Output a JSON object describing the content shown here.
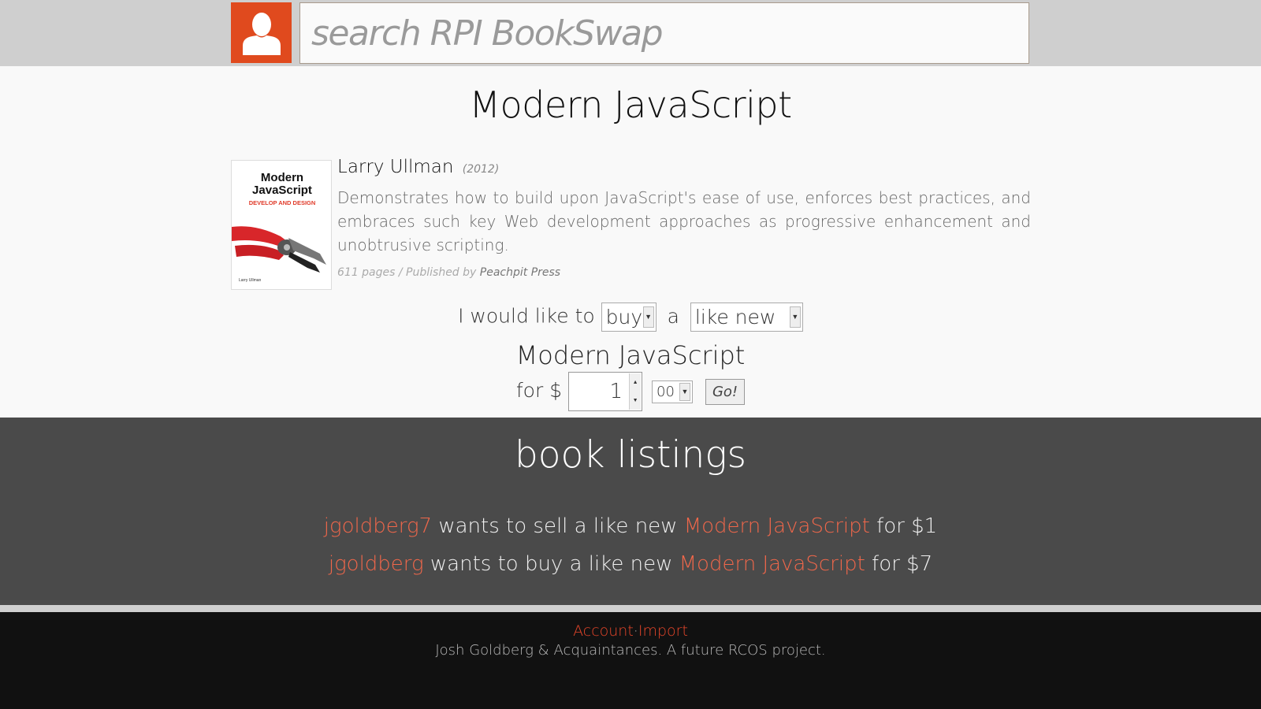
{
  "header": {
    "search_placeholder": "search RPI BookSwap",
    "account_icon": "user-icon",
    "accent": "#e04a1e"
  },
  "book": {
    "title": "Modern JavaScript",
    "author": "Larry Ullman",
    "year": "(2012)",
    "description": "Demonstrates how to build upon JavaScript's ease of use, enforces best practices, and embraces such key Web development approaches as progressive enhancement and unobtrusive scripting.",
    "meta_prefix": "611 pages / Published by",
    "publisher": "Peachpit Press",
    "cover": {
      "title_line1": "Modern",
      "title_line2": "JavaScript",
      "subtitle": "DEVELOP AND DESIGN",
      "author": "Larry Ullman"
    }
  },
  "offer": {
    "prefix": "I would like to",
    "action": "buy",
    "article": "a",
    "condition": "like new",
    "book_title": "Modern JavaScript",
    "price_label": "for $",
    "dollars": "1",
    "cents": "00",
    "go_label": "Go!"
  },
  "listings": {
    "title": "book listings",
    "items": [
      {
        "user": "jgoldberg7",
        "text1": " wants to sell a like new ",
        "book": "Modern JavaScript",
        "text2": " for $1"
      },
      {
        "user": "jgoldberg",
        "text1": " wants to buy a like new ",
        "book": "Modern JavaScript",
        "text2": " for $7"
      }
    ]
  },
  "footer": {
    "account_link": "Account",
    "separator": "·",
    "import_link": "Import",
    "credit": "Josh Goldberg & Acquaintances. A future RCOS project."
  }
}
